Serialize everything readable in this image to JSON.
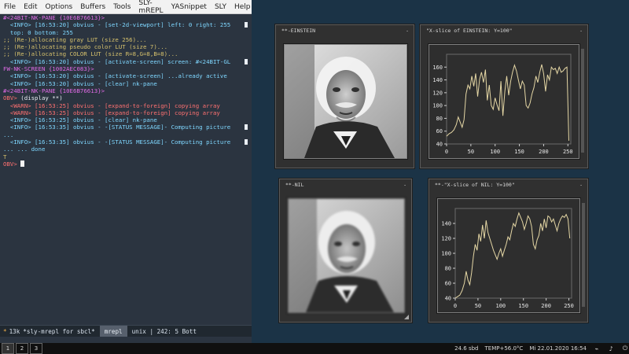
{
  "emacs": {
    "menubar": [
      "File",
      "Edit",
      "Options",
      "Buffers",
      "Tools",
      "SLY-mREPL",
      "YASnippet",
      "SLY",
      "Help"
    ],
    "lines": [
      {
        "text": "#<24BIT-NK-PANE {10E6B76613}>",
        "cls": "magenta"
      },
      {
        "text": "  <INFO> [16:53:20] obvius - [set-2d-viewport] left: 0 right: 255",
        "cls": "cyan",
        "wrap": true
      },
      {
        "text": "  top: 0 bottom: 255",
        "cls": "cyan"
      },
      {
        "text": ";; (Re-)allocating gray LUT (size 256)...",
        "cls": "yellow"
      },
      {
        "text": ";; (Re-)allocating pseudo color LUT (size 7)...",
        "cls": "yellow"
      },
      {
        "text": ";; (Re-)allocating COLOR LUT (size R=8,G=8,B=8)...",
        "cls": "yellow"
      },
      {
        "text": "  <INFO> [16:53:20] obvius - [activate-screen] screen: #<24BIT-GL",
        "cls": "cyan",
        "wrap": true
      },
      {
        "text": "FW-NK-SCREEN {1002AEC083}>",
        "cls": "magenta"
      },
      {
        "text": "  <INFO> [16:53:20] obvius - [activate-screen] ...already active",
        "cls": "cyan"
      },
      {
        "text": "  <INFO> [16:53:20] obvius - [clear] nk-pane",
        "cls": "cyan"
      },
      {
        "text": "#<24BIT-NK-PANE {10E6B76613}>",
        "cls": "magenta"
      },
      {
        "text": "OBV> (display **)",
        "cls": "prompt"
      },
      {
        "text": "  <WARN> [16:53:25] obvius - [expand-to-foreign] copying array",
        "cls": "red"
      },
      {
        "text": "  <WARN> [16:53:25] obvius - [expand-to-foreign] copying array",
        "cls": "red"
      },
      {
        "text": "  <INFO> [16:53:25] obvius - [clear] nk-pane",
        "cls": "cyan"
      },
      {
        "text": "  <INFO> [16:53:35] obvius - -[STATUS MESSAGE]- Computing picture",
        "cls": "cyan",
        "wrap": true
      },
      {
        "text": "...",
        "cls": "cyan"
      },
      {
        "text": "  <INFO> [16:53:35] obvius - -[STATUS MESSAGE]- Computing picture",
        "cls": "cyan",
        "wrap": true
      },
      {
        "text": "... ... done",
        "cls": "cyan"
      },
      {
        "text": "T",
        "cls": "yellow"
      },
      {
        "text": "OBV> ",
        "cls": "prompt_cursor"
      }
    ],
    "modeline": {
      "star": "*",
      "size": "13k",
      "buffer": "*sly-mrepl for sbcl*",
      "mode": "mrepl",
      "right": "unix | 242: 5  Bott"
    }
  },
  "windows": {
    "einstein": {
      "title": "**-EINSTEIN",
      "minimize": "-"
    },
    "xslice_einstein": {
      "title": "\"X-slice of EINSTEIN: Y=100\"",
      "minimize": "-",
      "chart_data": {
        "type": "line",
        "title": "",
        "xticks": [
          0,
          50,
          100,
          150,
          200,
          250
        ],
        "yticks": [
          40,
          60,
          80,
          100,
          120,
          140,
          160
        ],
        "xlim": [
          0,
          256
        ],
        "ylim": [
          40,
          180
        ],
        "color": "#e5d7a5",
        "x": [
          0,
          5,
          10,
          15,
          20,
          24,
          28,
          32,
          36,
          40,
          44,
          48,
          52,
          56,
          60,
          64,
          68,
          72,
          76,
          80,
          84,
          88,
          92,
          96,
          100,
          104,
          108,
          112,
          116,
          120,
          124,
          128,
          132,
          136,
          140,
          144,
          148,
          152,
          156,
          160,
          164,
          168,
          172,
          176,
          180,
          184,
          188,
          192,
          196,
          200,
          204,
          208,
          212,
          216,
          220,
          224,
          228,
          232,
          236,
          240,
          244,
          248,
          252
        ],
        "y": [
          52,
          56,
          58,
          62,
          70,
          82,
          74,
          66,
          78,
          118,
          132,
          126,
          146,
          130,
          150,
          114,
          141,
          152,
          136,
          156,
          108,
          132,
          100,
          94,
          112,
          101,
          92,
          138,
          84,
          122,
          146,
          116,
          138,
          152,
          163,
          154,
          140,
          126,
          138,
          132,
          100,
          96,
          104,
          118,
          128,
          146,
          136,
          152,
          164,
          150,
          122,
          148,
          140,
          160,
          156,
          158,
          150,
          160,
          152,
          154,
          158,
          160,
          45
        ]
      }
    },
    "nil": {
      "title": "**-NIL",
      "minimize": "-"
    },
    "xslice_nil": {
      "title": "**-\"X-slice of NIL: Y=100\"",
      "minimize": "-",
      "chart_data": {
        "type": "line",
        "title": "",
        "xticks": [
          0,
          50,
          100,
          150,
          200,
          250
        ],
        "yticks": [
          40,
          60,
          80,
          100,
          120,
          140
        ],
        "xlim": [
          0,
          256
        ],
        "ylim": [
          40,
          160
        ],
        "color": "#e5d7a5",
        "x": [
          0,
          5,
          10,
          15,
          20,
          24,
          28,
          32,
          36,
          40,
          44,
          48,
          52,
          56,
          60,
          64,
          68,
          72,
          76,
          80,
          84,
          88,
          92,
          96,
          100,
          104,
          108,
          112,
          116,
          120,
          124,
          128,
          132,
          136,
          140,
          144,
          148,
          152,
          156,
          160,
          164,
          168,
          172,
          176,
          180,
          184,
          188,
          192,
          196,
          200,
          204,
          208,
          212,
          216,
          220,
          224,
          228,
          232,
          236,
          240,
          244,
          248,
          252
        ],
        "y": [
          40,
          42,
          44,
          50,
          60,
          76,
          64,
          58,
          74,
          96,
          112,
          104,
          126,
          116,
          138,
          120,
          144,
          128,
          120,
          112,
          104,
          98,
          92,
          100,
          106,
          96,
          104,
          112,
          122,
          118,
          130,
          140,
          136,
          146,
          154,
          148,
          142,
          132,
          140,
          150,
          146,
          136,
          112,
          106,
          118,
          124,
          140,
          130,
          146,
          134,
          150,
          148,
          142,
          146,
          138,
          130,
          140,
          146,
          150,
          148,
          152,
          146,
          120
        ]
      }
    }
  },
  "taskbar": {
    "workspaces": [
      "1",
      "2",
      "3"
    ],
    "net": "24.6 sbd",
    "temp": "TEMP+56.0°C",
    "datetime": "Mi 22.01.2020 16:54"
  }
}
